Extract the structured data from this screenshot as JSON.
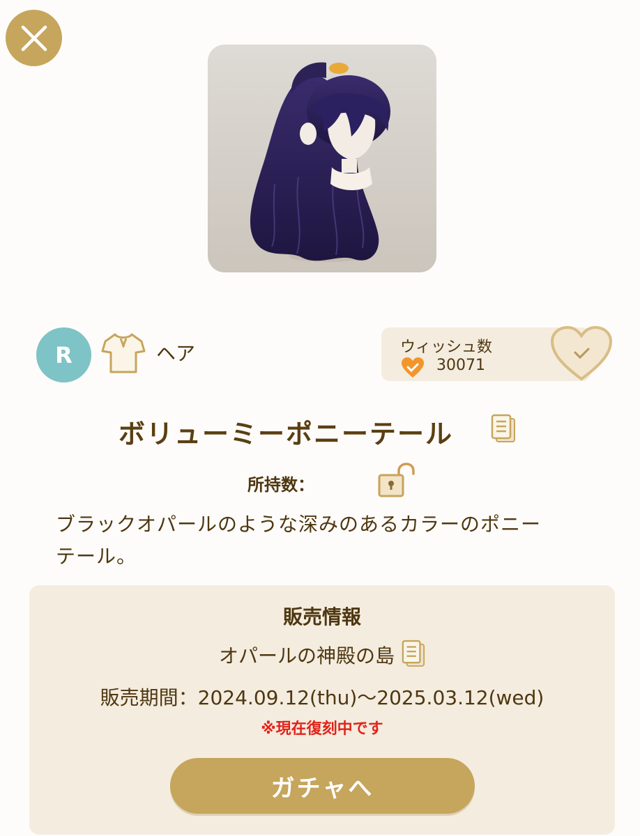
{
  "item": {
    "rarity": "R",
    "category_icon": "shirt-icon",
    "category_label": "ヘア",
    "title": "ボリューミーポニーテール",
    "owned_label": "所持数：",
    "description": "ブラックオパールのような深みのあるカラーのポニーテール。"
  },
  "wish": {
    "label": "ウィッシュ数",
    "count": "30071"
  },
  "sale": {
    "heading": "販売情報",
    "location": "オパールの神殿の島",
    "period_label": "販売期間：",
    "period_value": "2024.09.12(thu)～2025.03.12(wed)",
    "notice": "※現在復刻中です",
    "button_label": "ガチャへ"
  },
  "colors": {
    "accent_gold": "#c6a55c",
    "panel_beige": "#f4ecdf",
    "text_brown": "#4e3710",
    "rarity_teal": "#7ec3c6",
    "notice_red": "#e2231a",
    "heart_orange": "#f2962b"
  }
}
